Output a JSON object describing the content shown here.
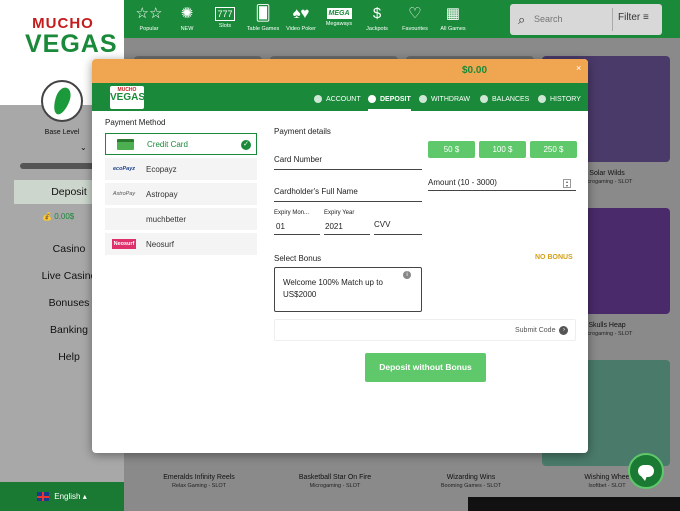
{
  "header": {
    "brand_top": "MUCHO",
    "brand_bottom": "VEGAS",
    "nav": [
      {
        "label": "Popular",
        "icon": "stars-icon",
        "glyph": "☆☆"
      },
      {
        "label": "NEW",
        "icon": "new-badge-icon",
        "glyph": "✺"
      },
      {
        "label": "Slots",
        "icon": "slots-icon",
        "glyph": "777"
      },
      {
        "label": "Table Games",
        "icon": "table-games-icon",
        "glyph": "🂠"
      },
      {
        "label": "Video Poker",
        "icon": "video-poker-icon",
        "glyph": "♠♥"
      },
      {
        "label": "Megaways",
        "icon": "megaways-icon",
        "glyph": "MEGA"
      },
      {
        "label": "Jackpots",
        "icon": "jackpot-icon",
        "glyph": "$"
      },
      {
        "label": "Favourites",
        "icon": "heart-icon",
        "glyph": "♡"
      },
      {
        "label": "All Games",
        "icon": "all-games-icon",
        "glyph": "▦"
      }
    ],
    "search_placeholder": "Search",
    "filter_label": "Filter ≡"
  },
  "sidebar": {
    "level": "Base Level",
    "deposit": "Deposit",
    "balance": "0.00$",
    "items": [
      "Casino",
      "Live Casino",
      "Bonuses",
      "Banking",
      "Help"
    ],
    "language": "English ▴"
  },
  "games": [
    {
      "name": "Solar Wilds",
      "sub": "Microgaming - SLOT"
    },
    {
      "name": "Skulls Heap",
      "sub": "Microgaming - SLOT"
    },
    {
      "name": "Emeralds Infinity Reels",
      "sub": "Relax Gaming - SLOT"
    },
    {
      "name": "Basketball Star On Fire",
      "sub": "Microgaming - SLOT"
    },
    {
      "name": "Wizarding Wins",
      "sub": "Booming Games - SLOT"
    },
    {
      "name": "Wishing Whee",
      "sub": "Isoftbet - SLOT"
    }
  ],
  "modal": {
    "balance": "$0.00",
    "close": "×",
    "logo_top": "MUCHO",
    "logo_bottom": "VEGAS",
    "tabs": [
      {
        "label": "ACCOUNT",
        "icon": "account-icon"
      },
      {
        "label": "DEPOSIT",
        "icon": "deposit-icon"
      },
      {
        "label": "WITHDRAW",
        "icon": "withdraw-icon"
      },
      {
        "label": "BALANCES",
        "icon": "balances-icon"
      },
      {
        "label": "HISTORY",
        "icon": "history-icon"
      }
    ],
    "payment_method_title": "Payment Method",
    "methods": [
      {
        "label": "Credit Card",
        "logo": ""
      },
      {
        "label": "Ecopayz",
        "logo": "ecoPayz"
      },
      {
        "label": "Astropay",
        "logo": "AstroPay"
      },
      {
        "label": "muchbetter",
        "logo": ""
      },
      {
        "label": "Neosurf",
        "logo": "Neosurf"
      }
    ],
    "payment_details_title": "Payment details",
    "card_number_label": "Card Number",
    "holder_label": "Cardholder's Full Name",
    "expiry_month_label": "Expiry Mon...",
    "expiry_month_value": "01",
    "expiry_year_label": "Expiry Year",
    "expiry_year_value": "2021",
    "cvv_label": "CVV",
    "amount_buttons": [
      "50 $",
      "100 $",
      "250 $"
    ],
    "amount_label": "Amount (10 - 3000)",
    "select_bonus": "Select Bonus",
    "no_bonus": "NO BONUS",
    "bonus_text": "Welcome 100% Match up to US$2000",
    "submit_code": "Submit Code",
    "deposit_button": "Deposit without Bonus"
  }
}
